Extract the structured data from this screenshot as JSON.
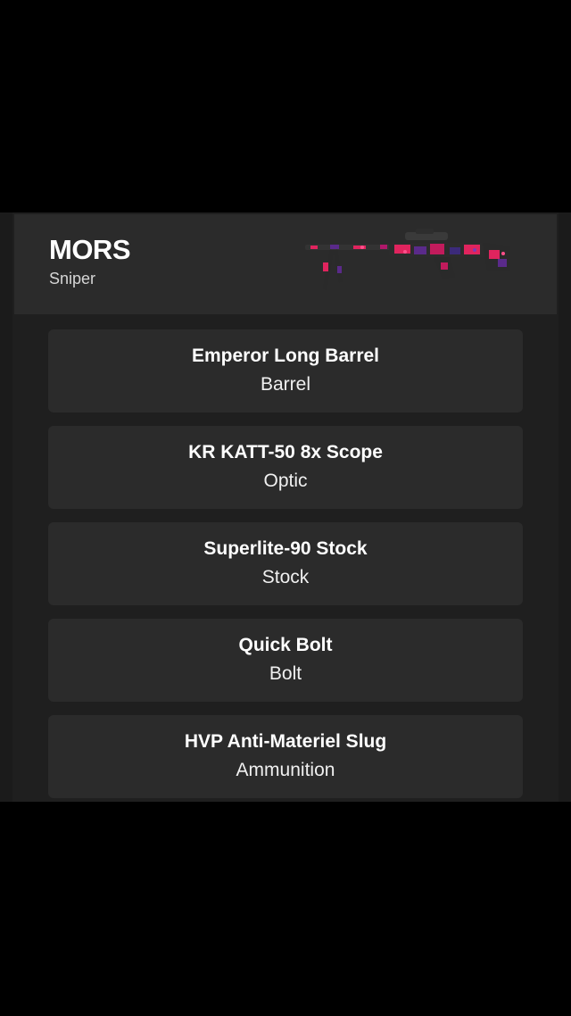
{
  "weapon": {
    "name": "MORS",
    "class": "Sniper",
    "image_icon": "sniper-rifle-camo-image"
  },
  "attachments": [
    {
      "name": "Emperor Long Barrel",
      "slot": "Barrel"
    },
    {
      "name": "KR KATT-50 8x Scope",
      "slot": "Optic"
    },
    {
      "name": "Superlite-90 Stock",
      "slot": "Stock"
    },
    {
      "name": "Quick Bolt",
      "slot": "Bolt"
    },
    {
      "name": "HVP Anti-Materiel Slug",
      "slot": "Ammunition"
    }
  ],
  "colors": {
    "background": "#000000",
    "panel": "#1f1f1f",
    "card": "#2b2b2b",
    "camo_pink": "#e0245e",
    "camo_purple": "#5a2a8a",
    "text": "#ffffff"
  }
}
